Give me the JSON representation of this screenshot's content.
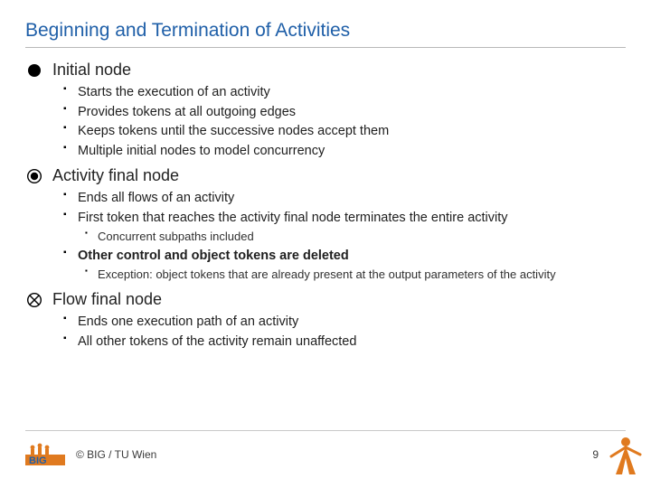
{
  "title": "Beginning and Termination of Activities",
  "sections": {
    "initial": {
      "label": "Initial node",
      "items": [
        "Starts the execution of an activity",
        "Provides tokens at all outgoing edges",
        "Keeps tokens until the successive nodes accept them",
        "Multiple initial nodes to model concurrency"
      ]
    },
    "activityFinal": {
      "label": "Activity final node",
      "items": {
        "b0": "Ends all flows of an activity",
        "b1": "First token that reaches the activity final node terminates the entire activity",
        "b1_0": "Concurrent subpaths included",
        "b2": "Other control and object tokens are deleted",
        "b2_0": "Exception: object tokens that are already present at the output parameters of the activity"
      }
    },
    "flowFinal": {
      "label": "Flow final node",
      "items": [
        "Ends one execution path of an activity",
        "All other tokens of the activity remain unaffected"
      ]
    }
  },
  "footer": {
    "copyright": "© BIG / TU Wien",
    "page": "9"
  },
  "icons": {
    "initial": "initial-node-icon",
    "activityFinal": "activity-final-node-icon",
    "flowFinal": "flow-final-node-icon",
    "logo": "big-logo-icon",
    "person": "person-icon"
  }
}
